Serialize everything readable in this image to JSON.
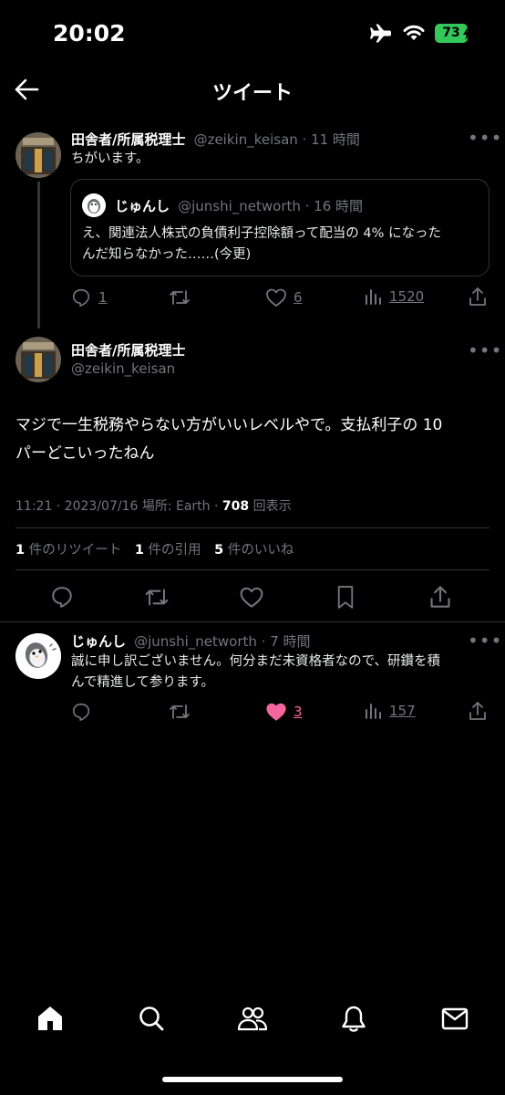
{
  "status_bar": {
    "time": "20:02",
    "battery": "73"
  },
  "header": {
    "title": "ツイート"
  },
  "parent_tweet": {
    "display_name": "田舎者/所属税理士",
    "handle_time": "@zeikin_keisan · 11 時間",
    "text": "ちがいます。",
    "quote": {
      "display_name": "じゅんし",
      "handle_time": "@junshi_networth · 16 時間",
      "text_line1": "え、関連法人株式の負債利子控除額って配当の 4% になった",
      "text_line2": "んだ知らなかった……(今更)"
    },
    "replies": "1",
    "likes": "6",
    "views": "1520"
  },
  "main_tweet": {
    "display_name": "田舎者/所属税理士",
    "handle": "@zeikin_keisan",
    "text_line1": "マジで一生税務やらない方がいいレベルやで。支払利子の 10",
    "text_line2": "パーどこいったねん",
    "meta_prefix": "11:21 · 2023/07/16 場所: Earth · ",
    "views_count": "708",
    "views_label": " 回表示",
    "retweets_count": "1",
    "retweets_label": " 件のリツイート",
    "quotes_count": "1",
    "quotes_label": " 件の引用",
    "likes_count": "5",
    "likes_label": " 件のいいね"
  },
  "reply_tweet": {
    "display_name": "じゅんし",
    "handle_time": "@junshi_networth · 7 時間",
    "text_line1": "誠に申し訳ございません。何分まだ未資格者なので、研鑽を積",
    "text_line2": "んで精進して参ります。",
    "likes": "3",
    "views": "157"
  },
  "colors": {
    "background": "#000000",
    "text": "#e7e9ea",
    "secondary": "#71767b",
    "like_pink": "#f91880",
    "battery_green": "#34c759"
  },
  "icons": [
    "back-arrow-icon",
    "reply-icon",
    "retweet-icon",
    "like-icon",
    "views-icon",
    "share-icon",
    "bookmark-icon",
    "home-icon",
    "search-icon",
    "communities-icon",
    "notifications-icon",
    "messages-icon"
  ]
}
